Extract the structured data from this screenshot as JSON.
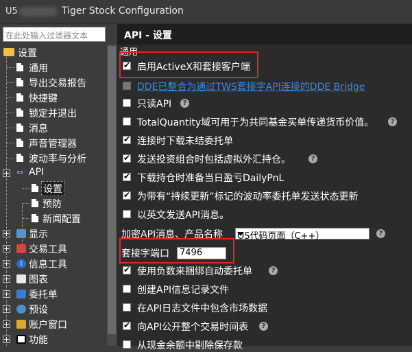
{
  "titlebar": {
    "prefix": "U5",
    "title": "Tiger Stock Configuration"
  },
  "filter": {
    "placeholder": "在此处输入过滤器文本"
  },
  "tree": {
    "root": "设置",
    "items": [
      "通用",
      "导出交易报告",
      "快捷键",
      "锁定并退出",
      "消息",
      "声音管理器",
      "波动率与分析"
    ],
    "api": "API",
    "api_children": [
      "设置",
      "预防",
      "新闻配置"
    ],
    "sections": [
      "显示",
      "交易工具",
      "信息工具",
      "图表",
      "委托单",
      "预设",
      "账户窗口",
      "功能"
    ]
  },
  "panel": {
    "header": "API - 设置",
    "group": "通用",
    "options": [
      {
        "label": "启用ActiveX和套接客户端",
        "checked": true
      },
      {
        "label": "DDE已整合为通过TWS套接字API连接的DDE Bridge",
        "checked": false,
        "disabled": true
      },
      {
        "label": "只读API",
        "checked": false
      },
      {
        "label": "TotalQuantity域可用于为共同基金买单传递货币价值。",
        "checked": false
      },
      {
        "label": "连接时下载未结委托单",
        "checked": true
      },
      {
        "label": "发送投资组合时包括虚拟外汇持仓。",
        "checked": true
      },
      {
        "label": "下载持仓时准备当日盈亏DailyPnL",
        "checked": true
      },
      {
        "label": "为带有“持续更新”标记的波动率委托单发送状态更新",
        "checked": true
      },
      {
        "label": "以英文发送API消息。",
        "checked": false
      }
    ],
    "encode_label": "加密API消息、产品名称",
    "encode_value": "OS代码页面（C++）",
    "port_label": "套接字端口",
    "port_value": "7496",
    "options2": [
      {
        "label": "使用负数来捆绑自动委托单",
        "checked": true
      },
      {
        "label": "创建API信息记录文件",
        "checked": false
      },
      {
        "label": "在API日志文件中包含市场数据",
        "checked": false
      },
      {
        "label": "向API公开整个交易时间表",
        "checked": true
      },
      {
        "label": "从现金余额中剔除保存款",
        "checked": false
      }
    ]
  },
  "colors": {
    "highlight": "#e0252b",
    "link": "#3d86e0"
  }
}
